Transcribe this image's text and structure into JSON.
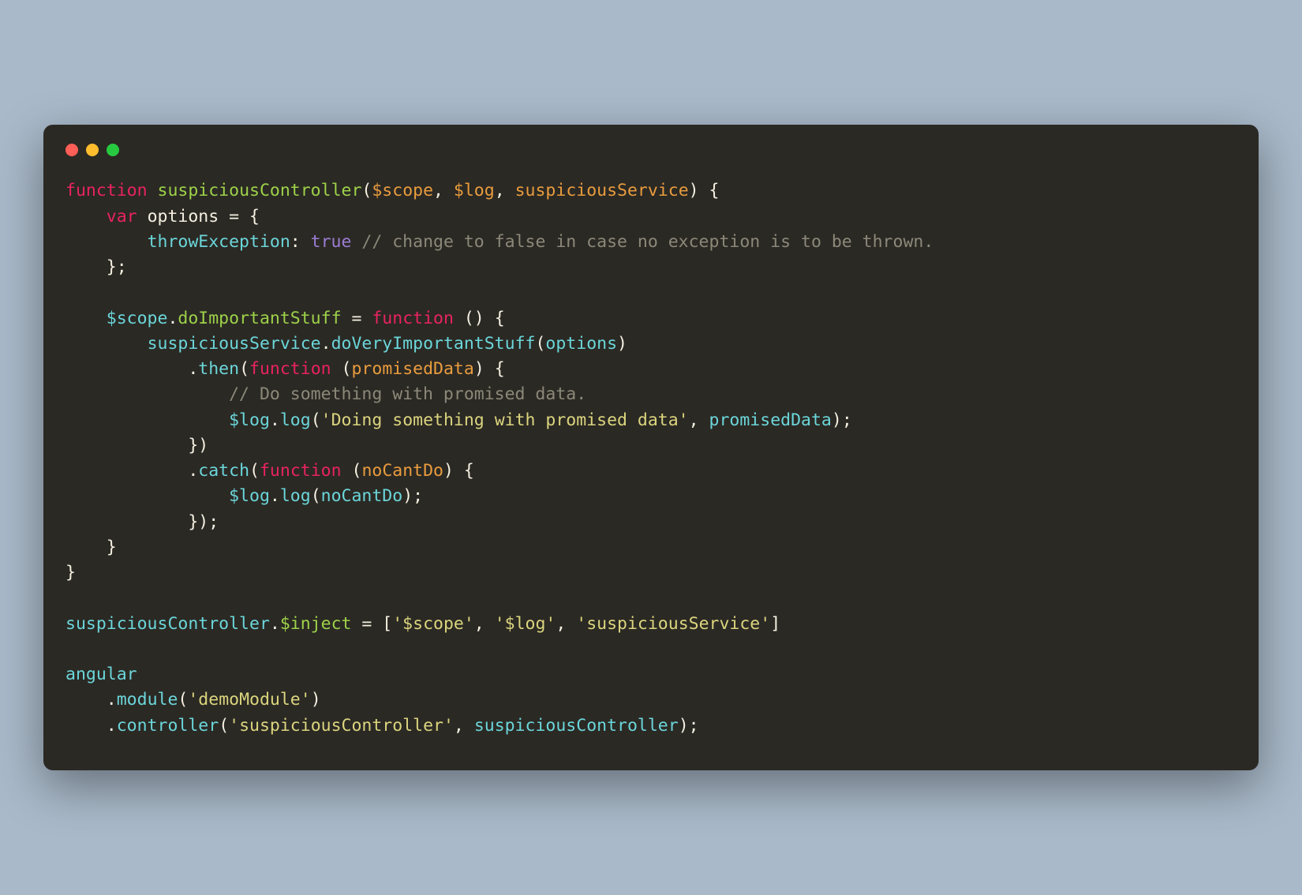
{
  "code": {
    "line1": {
      "kw_function": "function",
      "fn_name": "suspiciousController",
      "paren_open": "(",
      "param1": "$scope",
      "comma1": ", ",
      "param2": "$log",
      "comma2": ", ",
      "param3": "suspiciousService",
      "paren_close_brace": ") {"
    },
    "line2": {
      "indent": "    ",
      "kw_var": "var",
      "sp": " ",
      "name": "options",
      "eq": " = {"
    },
    "line3": {
      "indent": "        ",
      "prop": "throwException",
      "colon": ": ",
      "bool": "true",
      "sp": " ",
      "comment": "// change to false in case no exception is to be thrown."
    },
    "line4": {
      "indent": "    ",
      "close": "};"
    },
    "line5": "",
    "line6": {
      "indent": "    ",
      "obj": "$scope",
      "dot": ".",
      "prop": "doImportantStuff",
      "eq": " = ",
      "kw_function": "function",
      "rest": " () {"
    },
    "line7": {
      "indent": "        ",
      "obj": "suspiciousService",
      "dot": ".",
      "method": "doVeryImportantStuff",
      "paren_open": "(",
      "arg": "options",
      "paren_close": ")"
    },
    "line8": {
      "indent": "            ",
      "dot": ".",
      "method": "then",
      "paren_open": "(",
      "kw_function": "function",
      "sp": " (",
      "param": "promisedData",
      "rest": ") {"
    },
    "line9": {
      "indent": "                ",
      "comment": "// Do something with promised data."
    },
    "line10": {
      "indent": "                ",
      "obj": "$log",
      "dot": ".",
      "method": "log",
      "paren_open": "(",
      "str": "'Doing something with promised data'",
      "comma": ", ",
      "arg": "promisedData",
      "paren_close": ");"
    },
    "line11": {
      "indent": "            ",
      "close": "})"
    },
    "line12": {
      "indent": "            ",
      "dot": ".",
      "method": "catch",
      "paren_open": "(",
      "kw_function": "function",
      "sp": " (",
      "param": "noCantDo",
      "rest": ") {"
    },
    "line13": {
      "indent": "                ",
      "obj": "$log",
      "dot": ".",
      "method": "log",
      "paren_open": "(",
      "arg": "noCantDo",
      "paren_close": ");"
    },
    "line14": {
      "indent": "            ",
      "close": "});"
    },
    "line15": {
      "indent": "    ",
      "close": "}"
    },
    "line16": {
      "close": "}"
    },
    "line17": "",
    "line18": {
      "obj": "suspiciousController",
      "dot": ".",
      "prop": "$inject",
      "eq": " = [",
      "str1": "'$scope'",
      "c1": ", ",
      "str2": "'$log'",
      "c2": ", ",
      "str3": "'suspiciousService'",
      "close": "]"
    },
    "line19": "",
    "line20": {
      "obj": "angular"
    },
    "line21": {
      "indent": "    ",
      "dot": ".",
      "method": "module",
      "paren_open": "(",
      "str": "'demoModule'",
      "paren_close": ")"
    },
    "line22": {
      "indent": "    ",
      "dot": ".",
      "method": "controller",
      "paren_open": "(",
      "str": "'suspiciousController'",
      "comma": ", ",
      "arg": "suspiciousController",
      "paren_close": ");"
    }
  }
}
